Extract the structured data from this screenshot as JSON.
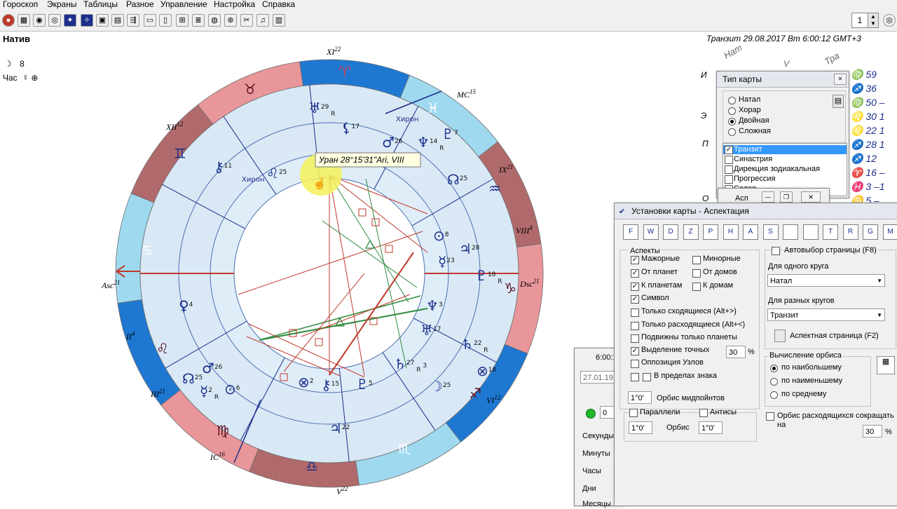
{
  "menu": [
    "Гороскоп",
    "Экраны",
    "Таблицы",
    "Разное",
    "Управление",
    "Настройка",
    "Справка"
  ],
  "toolbar": {
    "spin_value": "1"
  },
  "chart_header": {
    "left_title": "Натив",
    "moon_line_glyph": "☽",
    "moon_line_value": "8",
    "hour_label": "Час",
    "hour_glyphs": "☿ ⊕",
    "transit_header": "Транзит 29.08.2017  Вт  6:00:12 GMT+3"
  },
  "houses": {
    "xi": "XI",
    "xi_deg": "22",
    "xii": "XII",
    "xii_deg": "12",
    "ix": "IX",
    "ix_deg": "21",
    "viii": "VIII",
    "viii_deg": "4",
    "asc": "Asc",
    "asc_deg": "21",
    "dsc": "Dsc",
    "dsc_deg": "21",
    "ii": "II",
    "ii_deg": "4",
    "iii": "III",
    "iii_deg": "21",
    "vi": "VI",
    "vi_deg": "12",
    "ic": "IC",
    "ic_deg": "16",
    "v": "V",
    "v_deg": "22",
    "mc": "MC",
    "mc_deg": "15"
  },
  "planet_labels": [
    {
      "glyph": "♅",
      "deg": "29",
      "r": "R"
    },
    {
      "glyph": "⚸",
      "deg": "17"
    },
    {
      "glyph": "Хирон",
      "deg": ""
    },
    {
      "glyph": "♆",
      "deg": "14",
      "r": "R"
    },
    {
      "glyph": "♇",
      "deg": "7"
    },
    {
      "glyph": "⚷",
      "deg": "11"
    },
    {
      "glyph": "Хирон",
      "deg": ""
    },
    {
      "glyph": "♌",
      "deg": "25"
    },
    {
      "glyph": "♂",
      "deg": "26"
    },
    {
      "glyph": "☊",
      "deg": "25"
    },
    {
      "glyph": "⊙",
      "deg": "8"
    },
    {
      "glyph": "♃",
      "deg": "28"
    },
    {
      "glyph": "☿",
      "deg": "23"
    },
    {
      "glyph": "♇",
      "deg": "18",
      "r": "R"
    },
    {
      "glyph": "♀",
      "deg": "4"
    },
    {
      "glyph": "♆",
      "deg": "3"
    },
    {
      "glyph": "♅",
      "deg": "17"
    },
    {
      "glyph": "♄",
      "deg": "22",
      "r": "R"
    },
    {
      "glyph": "⊗",
      "deg": "18"
    },
    {
      "glyph": "♂",
      "deg": "26"
    },
    {
      "glyph": "☊",
      "deg": "25"
    },
    {
      "glyph": "☿",
      "deg": "2",
      "r": "R"
    },
    {
      "glyph": "⊙",
      "deg": "6"
    },
    {
      "glyph": "⊗",
      "deg": "2"
    },
    {
      "glyph": "⚷",
      "deg": "15"
    },
    {
      "glyph": "♇",
      "deg": "5"
    },
    {
      "glyph": "♄",
      "deg": "27",
      "r": "R",
      "deg2": "3"
    },
    {
      "glyph": "♃",
      "deg": "22"
    },
    {
      "glyph": "☽",
      "deg": "25"
    }
  ],
  "tooltip": "Уран 28°15'31\"Ari, VIII",
  "right_table": {
    "header_nat": "Нат",
    "header_v": "V",
    "header_tra": "Тра",
    "rows": [
      "♍ 59",
      "♐ 36",
      "♍ 50 –",
      "♌ 30  1",
      "♌ 22  1",
      "♐ 28  1",
      "♐ 12",
      "♈ 16 –",
      "♓  3 –1",
      "♋  5 –",
      "♏ 51 –"
    ],
    "left_letters": [
      "И",
      "Э",
      "П",
      "О"
    ]
  },
  "chart_type_win": {
    "title": "Тип карты",
    "radios": [
      "Натал",
      "Хорар",
      "Двойная",
      "Сложная"
    ],
    "selected": "Двойная",
    "list": [
      "Транзит",
      "Синастрия",
      "Дирекция зодиакальная",
      "Прогрессия",
      "Солар"
    ],
    "list_selected": "Транзит"
  },
  "small_win": {
    "title": "Асп"
  },
  "time_win": {
    "title": "6:00:1",
    "date_value": "27.01.19",
    "stepper_value": "0",
    "labels": [
      "Секунды",
      "Минуты",
      "Часы",
      "Дни",
      "Месяцы"
    ]
  },
  "settings_win": {
    "title": "Установки карты - Аспектация",
    "icons": [
      "F",
      "W",
      "D",
      "Z",
      "P",
      "H",
      "A",
      "S",
      "",
      "",
      "T",
      "R",
      "G",
      "M"
    ],
    "aspects_group": "Аспекты",
    "checks_left": [
      {
        "label": "Мажорные",
        "checked": true
      },
      {
        "label": "От планет",
        "checked": true
      },
      {
        "label": "К планетам",
        "checked": true
      },
      {
        "label": "Символ",
        "checked": true
      },
      {
        "label": "Только сходящиеся  (Alt+>)",
        "checked": false
      },
      {
        "label": "Только расходящиеся (Alt+<)",
        "checked": false
      },
      {
        "label": "Подвижны только планеты",
        "checked": false
      },
      {
        "label": "Выделение точных",
        "checked": true
      },
      {
        "label": "Оппозиция Узлов",
        "checked": false
      },
      {
        "label": "В пределах знака",
        "checked": false
      }
    ],
    "checks_right": [
      {
        "label": "Минорные",
        "checked": false
      },
      {
        "label": "От домов",
        "checked": false
      },
      {
        "label": "К домам",
        "checked": false
      }
    ],
    "exact_percent": "30",
    "percent_sign": "%",
    "orb_midpoints_value": "1°0'",
    "orb_midpoints_label": "Орбис мидпойнтов",
    "parallels_label": "Параллели",
    "antiscia_label": "Антисы",
    "orb_value_1": "1°0'",
    "orb_label": "Орбис",
    "orb_value_2": "1°0'",
    "auto_page_label": "Автовыбор страницы (F8)",
    "one_circle_label": "Для одного круга",
    "one_circle_value": "Натал",
    "diff_circles_label": "Для разных кругов",
    "diff_circles_value": "Транзит",
    "aspect_page_btn": "Аспектная страница (F2)",
    "orb_calc_group": "Вычисление орбиса",
    "orb_calc_options": [
      "по наибольшему",
      "по наименьшему",
      "по среднему"
    ],
    "orb_calc_selected": "по наибольшему",
    "shorten_label": "Орбис расходящихся сокращать на",
    "shorten_value": "30",
    "shorten_percent": "%"
  }
}
